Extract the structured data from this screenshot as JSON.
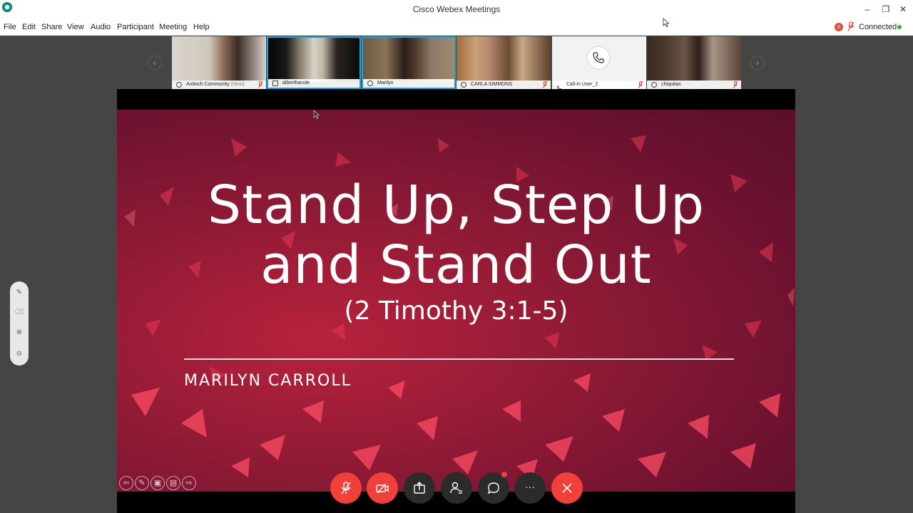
{
  "window": {
    "title": "Cisco Webex Meetings",
    "minimize_glyph": "–",
    "restore_glyph": "❐",
    "close_glyph": "✕"
  },
  "menu": {
    "items": [
      "File",
      "Edit",
      "Share",
      "View",
      "Audio",
      "Participant",
      "Meeting",
      "Help"
    ]
  },
  "status": {
    "recording_glyph": "o",
    "connection_text": "Connected"
  },
  "filmstrip": {
    "prev_glyph": "‹",
    "next_glyph": "›",
    "participants": [
      {
        "name": "Antioch Community",
        "role": "(Host)",
        "muted": true,
        "active": false
      },
      {
        "name": "alberthacole",
        "role": "",
        "muted": false,
        "active": true
      },
      {
        "name": "Marilyn",
        "role": "",
        "muted": false,
        "active": true
      },
      {
        "name": "CARLA SIMMONS",
        "role": "",
        "muted": true,
        "active": false
      },
      {
        "name": "Call-in User_2",
        "role": "",
        "muted": true,
        "active": false
      },
      {
        "name": "chiquitas",
        "role": "",
        "muted": true,
        "active": false
      }
    ]
  },
  "slide": {
    "title_line1": "Stand Up, Step Up",
    "title_line2": "and Stand Out",
    "subtitle": "(2 Timothy 3:1-5)",
    "author": "MARILYN CARROLL",
    "nav_glyphs": [
      "⇦",
      "✎",
      "▣",
      "▤",
      "⇨"
    ]
  },
  "side_tools": [
    "✎",
    "⌫",
    "⊕",
    "⊖"
  ],
  "controls": {
    "labels": [
      "mute",
      "stop-video",
      "share",
      "participants",
      "chat",
      "more",
      "leave"
    ],
    "more_glyph": "···"
  },
  "colors": {
    "accent_blue": "#19a3e0",
    "control_red": "#f1403a",
    "control_dark": "#2b2b2b",
    "connected_green": "#2fb344",
    "slide_crimson": "#8e1a35"
  }
}
